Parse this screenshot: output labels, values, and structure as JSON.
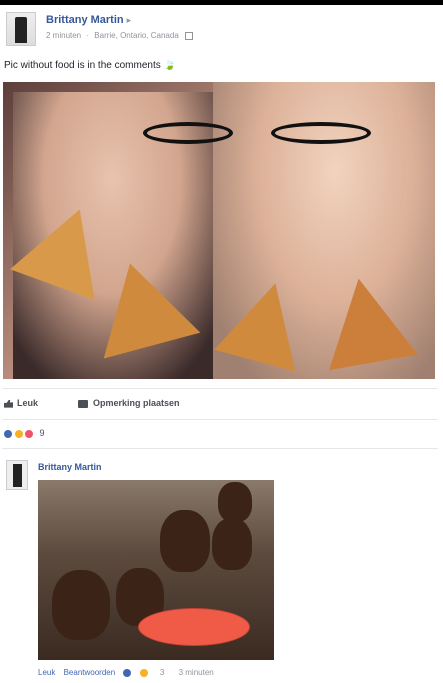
{
  "post": {
    "author": "Brittany Martin",
    "caret": "▸",
    "time": "2 minuten",
    "location": "Barrie, Ontario, Canada",
    "text": "Pic without food is in the comments",
    "emoji": "🍃"
  },
  "actions": {
    "like_label": "Leuk",
    "comment_label": "Opmerking plaatsen"
  },
  "reactions": {
    "count": "9"
  },
  "comment": {
    "author": "Brittany Martin",
    "like_label": "Leuk",
    "reply_label": "Beantwoorden",
    "reaction_count": "3",
    "time": "3 minuten"
  },
  "icons": {
    "like": "thumbs-up-icon",
    "comment": "comment-icon",
    "globe": "globe-icon"
  },
  "colors": {
    "link": "#365899",
    "meta": "#90949c",
    "reaction_like": "#4267b2",
    "reaction_love": "#f25268"
  }
}
